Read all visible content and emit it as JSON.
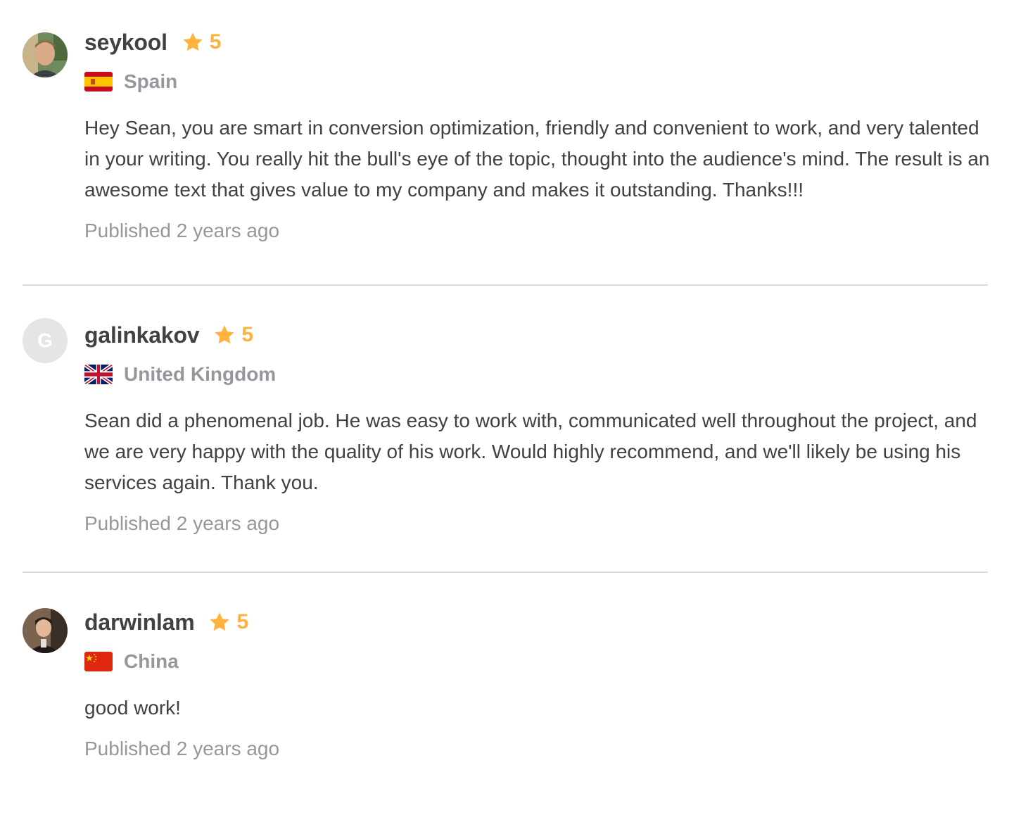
{
  "reviews": [
    {
      "username": "seykool",
      "rating": "5",
      "country": "Spain",
      "flag": "flag-spain-icon",
      "text": "Hey Sean, you are smart in conversion optimization, friendly and convenient to work, and very talented in your writing. You really hit the bull's eye of the topic, thought into the audience's mind. The result is an awesome text that gives value to my company and makes it outstanding. Thanks!!!",
      "published": "Published 2 years ago"
    },
    {
      "username": "galinkakov",
      "avatar_initial": "G",
      "rating": "5",
      "country": "United Kingdom",
      "flag": "flag-uk-icon",
      "text": "Sean did a phenomenal job. He was easy to work with, communicated well throughout the project, and we are very happy with the quality of his work. Would highly recommend, and we'll likely be using his services again. Thank you.",
      "published": "Published 2 years ago"
    },
    {
      "username": "darwinlam",
      "rating": "5",
      "country": "China",
      "flag": "flag-china-icon",
      "text": "good work!",
      "published": "Published 2 years ago"
    }
  ],
  "colors": {
    "star": "#ffb33e",
    "muted": "#95979d",
    "text": "#404145",
    "divider": "#dadbdd"
  }
}
